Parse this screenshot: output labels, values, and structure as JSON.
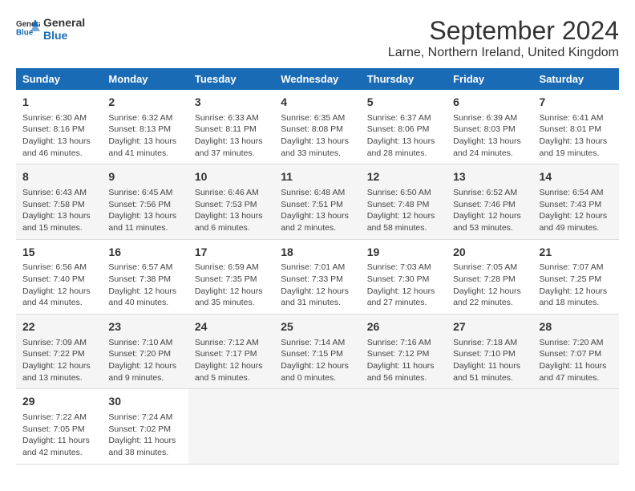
{
  "logo": {
    "general": "General",
    "blue": "Blue"
  },
  "title": "September 2024",
  "subtitle": "Larne, Northern Ireland, United Kingdom",
  "headers": [
    "Sunday",
    "Monday",
    "Tuesday",
    "Wednesday",
    "Thursday",
    "Friday",
    "Saturday"
  ],
  "weeks": [
    [
      {
        "day": "1",
        "sunrise": "6:30 AM",
        "sunset": "8:16 PM",
        "daylight": "13 hours and 46 minutes."
      },
      {
        "day": "2",
        "sunrise": "6:32 AM",
        "sunset": "8:13 PM",
        "daylight": "13 hours and 41 minutes."
      },
      {
        "day": "3",
        "sunrise": "6:33 AM",
        "sunset": "8:11 PM",
        "daylight": "13 hours and 37 minutes."
      },
      {
        "day": "4",
        "sunrise": "6:35 AM",
        "sunset": "8:08 PM",
        "daylight": "13 hours and 33 minutes."
      },
      {
        "day": "5",
        "sunrise": "6:37 AM",
        "sunset": "8:06 PM",
        "daylight": "13 hours and 28 minutes."
      },
      {
        "day": "6",
        "sunrise": "6:39 AM",
        "sunset": "8:03 PM",
        "daylight": "13 hours and 24 minutes."
      },
      {
        "day": "7",
        "sunrise": "6:41 AM",
        "sunset": "8:01 PM",
        "daylight": "13 hours and 19 minutes."
      }
    ],
    [
      {
        "day": "8",
        "sunrise": "6:43 AM",
        "sunset": "7:58 PM",
        "daylight": "13 hours and 15 minutes."
      },
      {
        "day": "9",
        "sunrise": "6:45 AM",
        "sunset": "7:56 PM",
        "daylight": "13 hours and 11 minutes."
      },
      {
        "day": "10",
        "sunrise": "6:46 AM",
        "sunset": "7:53 PM",
        "daylight": "13 hours and 6 minutes."
      },
      {
        "day": "11",
        "sunrise": "6:48 AM",
        "sunset": "7:51 PM",
        "daylight": "13 hours and 2 minutes."
      },
      {
        "day": "12",
        "sunrise": "6:50 AM",
        "sunset": "7:48 PM",
        "daylight": "12 hours and 58 minutes."
      },
      {
        "day": "13",
        "sunrise": "6:52 AM",
        "sunset": "7:46 PM",
        "daylight": "12 hours and 53 minutes."
      },
      {
        "day": "14",
        "sunrise": "6:54 AM",
        "sunset": "7:43 PM",
        "daylight": "12 hours and 49 minutes."
      }
    ],
    [
      {
        "day": "15",
        "sunrise": "6:56 AM",
        "sunset": "7:40 PM",
        "daylight": "12 hours and 44 minutes."
      },
      {
        "day": "16",
        "sunrise": "6:57 AM",
        "sunset": "7:38 PM",
        "daylight": "12 hours and 40 minutes."
      },
      {
        "day": "17",
        "sunrise": "6:59 AM",
        "sunset": "7:35 PM",
        "daylight": "12 hours and 35 minutes."
      },
      {
        "day": "18",
        "sunrise": "7:01 AM",
        "sunset": "7:33 PM",
        "daylight": "12 hours and 31 minutes."
      },
      {
        "day": "19",
        "sunrise": "7:03 AM",
        "sunset": "7:30 PM",
        "daylight": "12 hours and 27 minutes."
      },
      {
        "day": "20",
        "sunrise": "7:05 AM",
        "sunset": "7:28 PM",
        "daylight": "12 hours and 22 minutes."
      },
      {
        "day": "21",
        "sunrise": "7:07 AM",
        "sunset": "7:25 PM",
        "daylight": "12 hours and 18 minutes."
      }
    ],
    [
      {
        "day": "22",
        "sunrise": "7:09 AM",
        "sunset": "7:22 PM",
        "daylight": "12 hours and 13 minutes."
      },
      {
        "day": "23",
        "sunrise": "7:10 AM",
        "sunset": "7:20 PM",
        "daylight": "12 hours and 9 minutes."
      },
      {
        "day": "24",
        "sunrise": "7:12 AM",
        "sunset": "7:17 PM",
        "daylight": "12 hours and 5 minutes."
      },
      {
        "day": "25",
        "sunrise": "7:14 AM",
        "sunset": "7:15 PM",
        "daylight": "12 hours and 0 minutes."
      },
      {
        "day": "26",
        "sunrise": "7:16 AM",
        "sunset": "7:12 PM",
        "daylight": "11 hours and 56 minutes."
      },
      {
        "day": "27",
        "sunrise": "7:18 AM",
        "sunset": "7:10 PM",
        "daylight": "11 hours and 51 minutes."
      },
      {
        "day": "28",
        "sunrise": "7:20 AM",
        "sunset": "7:07 PM",
        "daylight": "11 hours and 47 minutes."
      }
    ],
    [
      {
        "day": "29",
        "sunrise": "7:22 AM",
        "sunset": "7:05 PM",
        "daylight": "11 hours and 42 minutes."
      },
      {
        "day": "30",
        "sunrise": "7:24 AM",
        "sunset": "7:02 PM",
        "daylight": "11 hours and 38 minutes."
      },
      null,
      null,
      null,
      null,
      null
    ]
  ],
  "labels": {
    "sunrise": "Sunrise: ",
    "sunset": "Sunset: ",
    "daylight": "Daylight hours"
  }
}
